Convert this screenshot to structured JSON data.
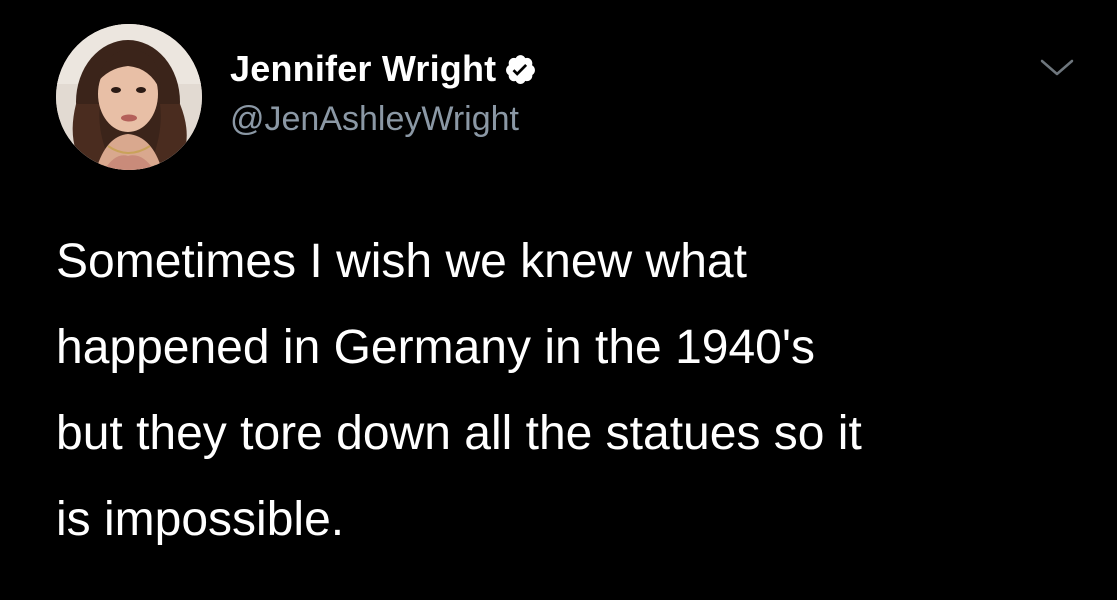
{
  "tweet": {
    "author": {
      "display_name": "Jennifer Wright",
      "handle": "@JenAshleyWright",
      "verified": true,
      "avatar_icon": "profile-photo"
    },
    "text": "Sometimes I wish we knew what\nhappened in Germany in the 1940's\nbut they tore down all the statues so it\nis impossible.",
    "menu_icon": "chevron-down-icon"
  },
  "colors": {
    "background": "#000000",
    "primary_text": "#ffffff",
    "secondary_text": "#8b98a5",
    "verified_badge": "#ffffff",
    "caret": "#6e767d"
  }
}
